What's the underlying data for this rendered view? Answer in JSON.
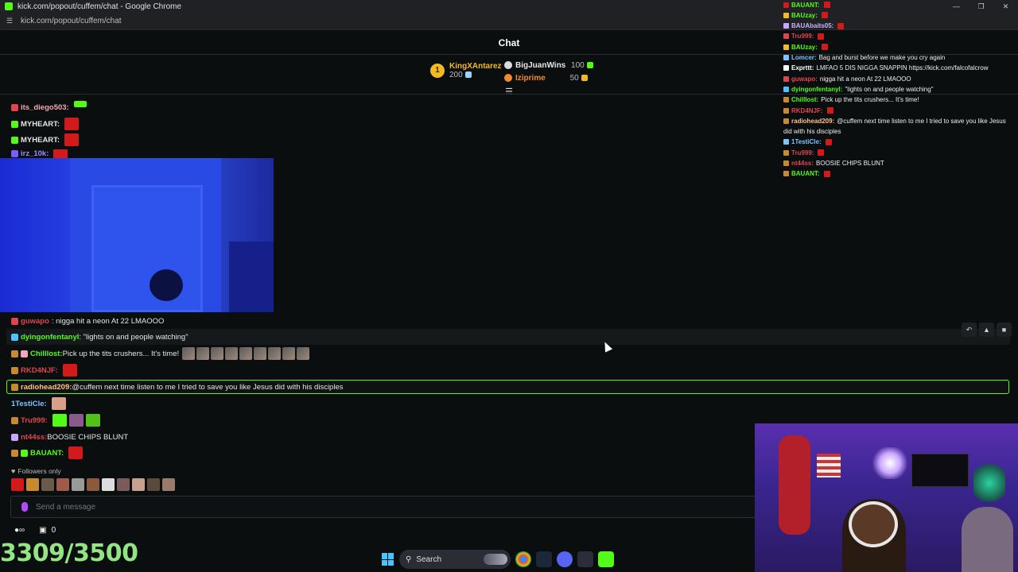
{
  "browser": {
    "title": "kick.com/popout/cuffem/chat - Google Chrome",
    "url": "kick.com/popout/cuffem/chat"
  },
  "chat": {
    "title": "Chat",
    "leaderboard": [
      {
        "rank": "1",
        "name": "KingXAntarez",
        "value": "200",
        "color": "#f5b921"
      },
      {
        "name": "BigJuanWins",
        "value": "100",
        "color": "#e8e8e8"
      },
      {
        "name": "Iziprime",
        "value": "50",
        "color": "#f08c2e"
      }
    ]
  },
  "messages_top": [
    {
      "user": "its_diego503:",
      "color": "#f4a6b9",
      "text": ""
    },
    {
      "user": "MYHEART:",
      "color": "#ffffff",
      "text": ""
    },
    {
      "user": "MYHEART:",
      "color": "#ffffff",
      "text": ""
    },
    {
      "user": "irz_10k:",
      "color": "#9c8cff",
      "text": ""
    }
  ],
  "messages": [
    {
      "user": "guwapo",
      "color": "#e0454e",
      "text": ": nigga hit a neon At 22 LMAOOO"
    },
    {
      "user": "dyingonfentanyl",
      "color": "#53fc18",
      "text": ": \"lights on and people watching\""
    },
    {
      "user": "Chilllost:",
      "color": "#53fc18",
      "text": " Pick up the tits crushers... It's time!"
    },
    {
      "user": "RKD4NJF:",
      "color": "#e0454e",
      "text": ""
    },
    {
      "user": "radiohead209:",
      "color": "#ffc38a",
      "text": " @cuffem next time listen to me I tried to save you like Jesus did with his disciples"
    },
    {
      "user": "1TestiCle:",
      "color": "#7cc3ff",
      "text": ""
    },
    {
      "user": "Tru999:",
      "color": "#e0454e",
      "text": ""
    },
    {
      "user": "nt44ss:",
      "color": "#e0454e",
      "text": " BOOSIE CHIPS BLUNT"
    },
    {
      "user": "BAUANT:",
      "color": "#53fc18",
      "text": ""
    }
  ],
  "footer": {
    "followers_only": "Followers only",
    "input_placeholder": "Send a message",
    "points": "0",
    "counter": "3309/3500"
  },
  "right_chat": [
    {
      "user": "BAUANT:",
      "color": "#53fc18",
      "text": ""
    },
    {
      "user": "BAUzay:",
      "color": "#53fc18",
      "text": ""
    },
    {
      "user": "BAUAbaits05:",
      "color": "#c9b3ff",
      "text": ""
    },
    {
      "user": "Tru999:",
      "color": "#e0454e",
      "text": ""
    },
    {
      "user": "BAUzay:",
      "color": "#53fc18",
      "text": ""
    },
    {
      "user": "Lomcer:",
      "color": "#7cc3ff",
      "text": "Bag and burst before we make you cry again"
    },
    {
      "user": "Exprttt:",
      "color": "#ffffff",
      "text": "LMFAO 5 DIS NIGGA SNAPPIN https://kick.com/falcofalcrow"
    },
    {
      "user": "guwapo:",
      "color": "#e0454e",
      "text": "nigga hit a neon At 22 LMAOOO"
    },
    {
      "user": "dyingonfentanyl:",
      "color": "#53fc18",
      "text": "\"lights on and people watching\""
    },
    {
      "user": "Chilllost:",
      "color": "#53fc18",
      "text": "Pick up the tits crushers... It's time!"
    },
    {
      "user": "RKD4NJF:",
      "color": "#e0454e",
      "text": ""
    },
    {
      "user": "radiohead209:",
      "color": "#ffc38a",
      "text": "@cuffem next time listen to me I tried to save you like Jesus"
    },
    {
      "user": "",
      "color": "#f0f0f0",
      "text": "did with his disciples"
    },
    {
      "user": "1TestiCle:",
      "color": "#7cc3ff",
      "text": ""
    },
    {
      "user": "Tru999:",
      "color": "#e0454e",
      "text": ""
    },
    {
      "user": "nt44ss:",
      "color": "#e0454e",
      "text": "BOOSIE CHIPS BLUNT"
    },
    {
      "user": "BAUANT:",
      "color": "#53fc18",
      "text": ""
    }
  ],
  "taskbar": {
    "search_label": "Search"
  }
}
